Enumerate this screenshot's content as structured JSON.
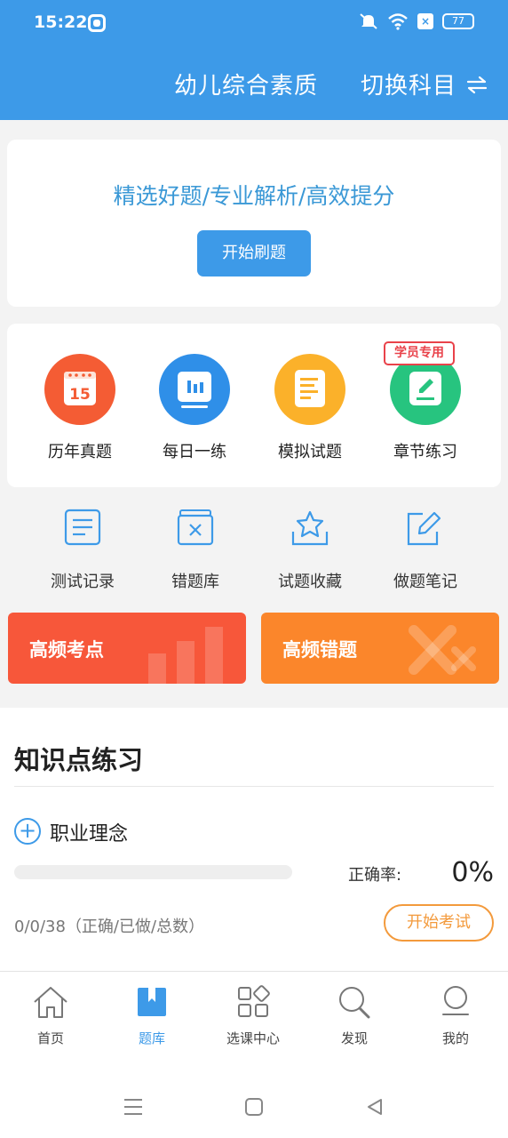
{
  "status": {
    "time": "15:22",
    "battery": "77"
  },
  "header": {
    "subject": "幼儿综合素质",
    "switch_label": "切换科目",
    "switch_icon": "swap-arrows-icon"
  },
  "hero": {
    "title": "精选好题/专业解析/高效提分",
    "button": "开始刷题"
  },
  "categories": [
    {
      "label": "历年真题",
      "icon": "calendar-icon",
      "color": "#f45c34",
      "badge": "15"
    },
    {
      "label": "每日一练",
      "icon": "daily-chart-icon",
      "color": "#2f8fe8"
    },
    {
      "label": "模拟试题",
      "icon": "document-icon",
      "color": "#fbb12a"
    },
    {
      "label": "章节练习",
      "icon": "edit-note-icon",
      "color": "#27c47f"
    }
  ],
  "member_tag": "学员专用",
  "tools": [
    {
      "label": "测试记录",
      "icon": "record-icon"
    },
    {
      "label": "错题库",
      "icon": "wrong-book-icon"
    },
    {
      "label": "试题收藏",
      "icon": "star-tray-icon"
    },
    {
      "label": "做题笔记",
      "icon": "note-pencil-icon"
    }
  ],
  "banners": [
    {
      "label": "高频考点",
      "color": "#f7573a"
    },
    {
      "label": "高频错题",
      "color": "#fb862b"
    }
  ],
  "knowledge": {
    "title": "知识点练习",
    "item": "职业理念",
    "progress": 0,
    "accuracy_label": "正确率:",
    "accuracy_value": "0%",
    "stats": "0/0/38（正确/已做/总数）",
    "exam_button": "开始考试"
  },
  "nav": [
    {
      "label": "首页",
      "icon": "home-icon",
      "active": false
    },
    {
      "label": "题库",
      "icon": "question-bank-icon",
      "active": true
    },
    {
      "label": "选课中心",
      "icon": "course-center-icon",
      "active": false
    },
    {
      "label": "发现",
      "icon": "discover-search-icon",
      "active": false
    },
    {
      "label": "我的",
      "icon": "profile-icon",
      "active": false
    }
  ]
}
